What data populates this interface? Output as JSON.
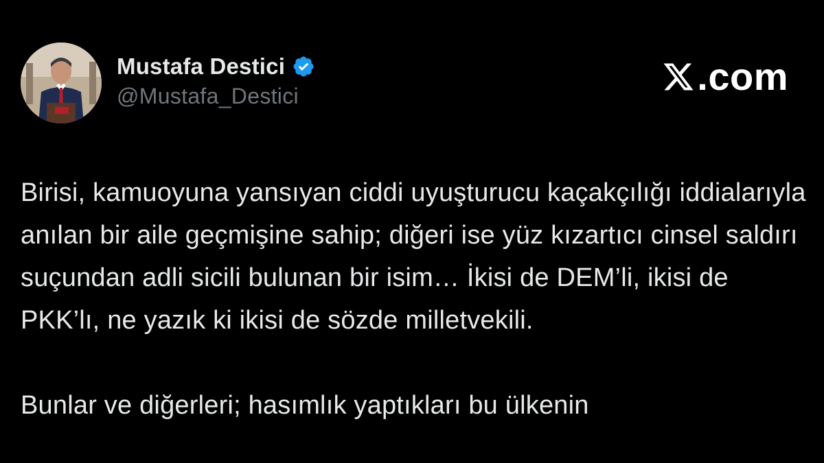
{
  "author": {
    "display_name": "Mustafa Destici",
    "handle": "@Mustafa_Destici",
    "verified": true,
    "verified_color": "#1d9bf0",
    "avatar_icon": "profile-photo"
  },
  "brand": {
    "label": ".com",
    "logo_icon": "x-logo-icon"
  },
  "tweet": {
    "paragraph_1": "Birisi, kamuoyuna yansıyan ciddi uyuşturucu kaçakçılığı iddialarıyla anılan bir aile geçmişine sahip; diğeri ise yüz kızartıcı cinsel saldırı suçundan adli sicili bulunan bir isim… İkisi de DEM’li, ikisi de PKK’lı, ne yazık ki ikisi de sözde milletvekili.",
    "paragraph_2": "Bunlar ve diğerleri; hasımlık yaptıkları bu ülkenin"
  },
  "colors": {
    "background": "#000000",
    "text": "#e7e9ea",
    "muted": "#71767b"
  }
}
